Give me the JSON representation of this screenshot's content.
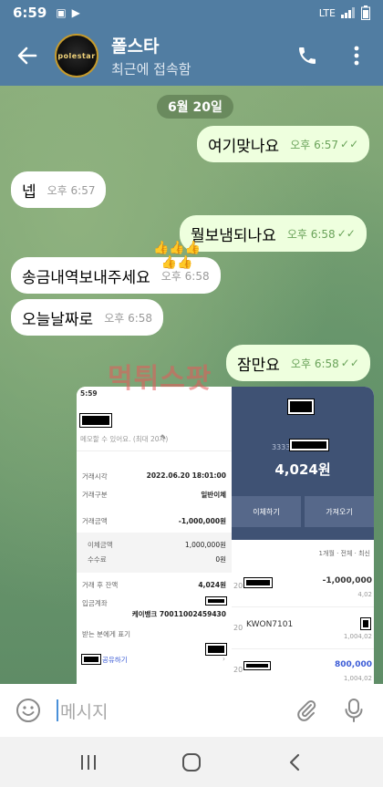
{
  "status": {
    "time": "6:59",
    "network": "LTE"
  },
  "header": {
    "back_icon": "arrow-left-icon",
    "avatar_text": "polestar",
    "title": "폴스타",
    "subtitle": "최근에 접속함",
    "call_icon": "phone-icon",
    "menu_icon": "more-vertical-icon"
  },
  "chat": {
    "date": "6월 20일",
    "watermark": "먹튀스팟",
    "messages": [
      {
        "text": "여기맞나요",
        "time": "오후 6:57",
        "direction": "out",
        "read": true
      },
      {
        "text": "넵",
        "time": "오후 6:57",
        "direction": "in"
      },
      {
        "text": "뭘보냄되나요",
        "time": "오후 6:58",
        "direction": "out",
        "read": true
      },
      {
        "text": "송금내역보내주세요",
        "time": "오후 6:58",
        "direction": "in"
      },
      {
        "text": "오늘날짜로",
        "time": "오후 6:58",
        "direction": "in"
      },
      {
        "text": "잠만요",
        "time": "오후 6:58",
        "direction": "out",
        "read": true
      }
    ],
    "photo": {
      "left": {
        "status_time": "5:59",
        "memo_placeholder": "메모할 수 있어요. (최대 20자)",
        "rows": [
          {
            "k": "거래시각",
            "v": "2022.06.20 18:01:00"
          },
          {
            "k": "거래구분",
            "v": "일반이체"
          },
          {
            "k": "거래금액",
            "v": "-1,000,000원"
          },
          {
            "k": "이체금액",
            "v": "1,000,000원"
          },
          {
            "k": "수수료",
            "v": "0원"
          },
          {
            "k": "거래 후 잔액",
            "v": "4,024원"
          },
          {
            "k": "입금계좌",
            "v": ""
          },
          {
            "k": "",
            "v": "케이뱅크 70011002459430"
          },
          {
            "k": "받는 분에게 표기",
            "v": ""
          }
        ],
        "share_label": "공유하기"
      },
      "right": {
        "account_prefix": "3333",
        "balance": "4,024원",
        "transfer_btn": "이체하기",
        "fetch_btn": "가져오기",
        "filter": "1개월 · 전체 · 최신",
        "entries": [
          {
            "day": "20",
            "name": "",
            "amount": "-1,000,000",
            "sub": "4,02"
          },
          {
            "day": "20",
            "name": "KWON7101",
            "amount": "",
            "sub": "1,004,02"
          },
          {
            "day": "20",
            "name": "",
            "amount": "800,000",
            "sub": "1,004,02"
          }
        ]
      }
    }
  },
  "input": {
    "placeholder": "메시지",
    "emoji_icon": "smiley-icon",
    "attach_icon": "paperclip-icon",
    "mic_icon": "microphone-icon"
  },
  "nav": {
    "recents_icon": "recents-icon",
    "home_icon": "home-icon",
    "back_icon": "back-chevron-icon"
  }
}
